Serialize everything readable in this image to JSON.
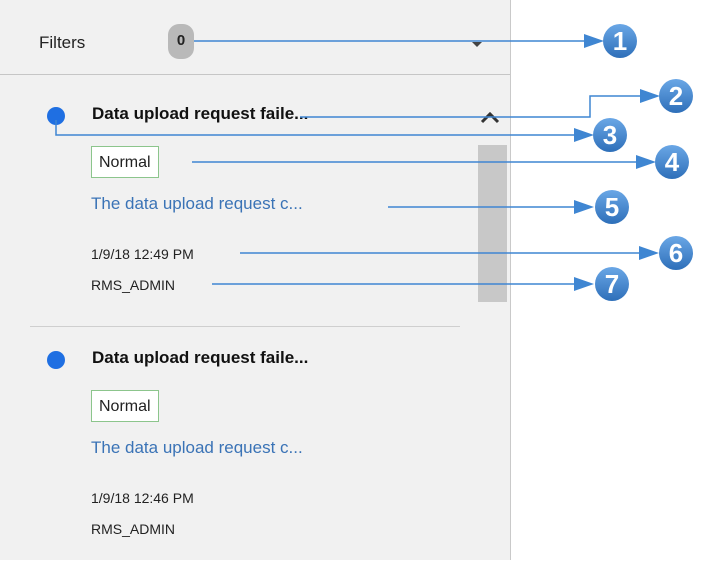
{
  "filters": {
    "label": "Filters",
    "count": "0"
  },
  "notifications": [
    {
      "title": "Data upload request faile...",
      "priority": "Normal",
      "description": "The data upload request c...",
      "timestamp": "1/9/18 12:49 PM",
      "user": "RMS_ADMIN"
    },
    {
      "title": "Data upload request faile...",
      "priority": "Normal",
      "description": "The data upload request c...",
      "timestamp": "1/9/18 12:46 PM",
      "user": "RMS_ADMIN"
    }
  ],
  "callouts": [
    "1",
    "2",
    "3",
    "4",
    "5",
    "6",
    "7"
  ],
  "colors": {
    "unread_dot": "#1f6fe2",
    "callout": "#3f86d2",
    "link_text": "#3a73b6",
    "badge_border": "#8cc58c"
  }
}
